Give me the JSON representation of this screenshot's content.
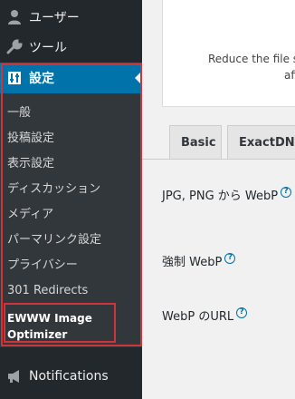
{
  "sidebar": {
    "users_label": "ユーザー",
    "tools_label": "ツール",
    "settings_label": "設定",
    "notifications_label": "Notifications",
    "submenu": [
      "一般",
      "投稿設定",
      "表示設定",
      "ディスカッション",
      "メディア",
      "パーマリンク設定",
      "プライバシー",
      "301 Redirects"
    ],
    "current_item": [
      "EWWW Image",
      "Optimizer"
    ]
  },
  "notice": {
    "line1": "Reduce the file si",
    "line2": "affe"
  },
  "tabs": [
    {
      "label": "Basic"
    },
    {
      "label": "ExactDN"
    }
  ],
  "fields": {
    "jpg_png_webp": "JPG, PNG から WebP",
    "force_webp": "強制 WebP",
    "webp_url": "WebP のURL",
    "help_mark": "?"
  },
  "colors": {
    "sidebar_bg": "#23282d",
    "submenu_bg": "#32373c",
    "active_bg": "#0073aa",
    "annotation": "#d0343b"
  }
}
